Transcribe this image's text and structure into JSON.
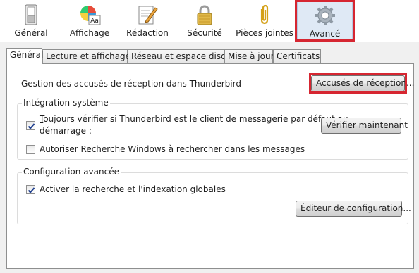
{
  "toolbar": {
    "items": [
      {
        "label": "Général",
        "icon": "general-switch-icon"
      },
      {
        "label": "Affichage",
        "icon": "display-palette-icon"
      },
      {
        "label": "Rédaction",
        "icon": "composition-pencil-icon"
      },
      {
        "label": "Sécurité",
        "icon": "padlock-icon"
      },
      {
        "label": "Pièces jointes",
        "icon": "paperclip-icon"
      },
      {
        "label": "Avancé",
        "icon": "gear-icon",
        "active": true
      }
    ]
  },
  "tabs": [
    {
      "label": "Général",
      "selected": true
    },
    {
      "label": "Lecture et affichage"
    },
    {
      "label": "Réseau et espace disque"
    },
    {
      "label": "Mise à jour"
    },
    {
      "label": "Certificats"
    }
  ],
  "receipts": {
    "label": "Gestion des accusés de réception dans Thunderbird",
    "button_accel": "A",
    "button_rest": "ccusés de réception..."
  },
  "system": {
    "title": "Intégration système",
    "default_check": {
      "checked": true,
      "accel": "T",
      "line1_rest": "oujours vérifier si Thunderbird est le client de messagerie par défaut au",
      "line2": "démarrage :"
    },
    "check_now_accel": "V",
    "check_now_rest": "érifier maintenant",
    "windows_search": {
      "checked": false,
      "accel": "A",
      "rest": "utoriser Recherche Windows à rechercher dans les messages"
    }
  },
  "advanced": {
    "title": "Configuration avancée",
    "global_search": {
      "checked": true,
      "accel": "A",
      "rest": "ctiver la recherche et l'indexation globales"
    },
    "config_editor_accel": "É",
    "config_editor_rest": "diteur de configuration..."
  },
  "colors": {
    "highlight": "#d62631",
    "active_tab_bg": "#dfe9f5",
    "check_mark": "#1f3f8f"
  }
}
